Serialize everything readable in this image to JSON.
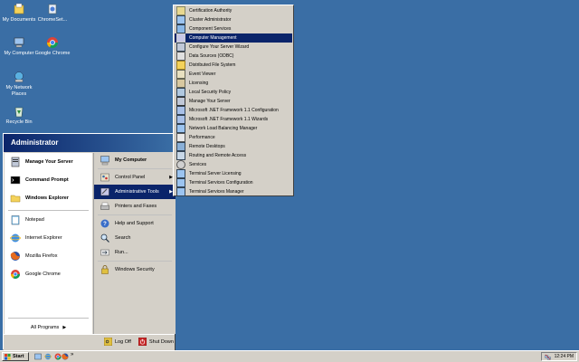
{
  "desktop": {
    "icons": [
      {
        "label": "My Documents",
        "icon": "my-documents-icon"
      },
      {
        "label": "ChromeSet...",
        "icon": "chrome-setup-icon"
      },
      {
        "label": "My Computer",
        "icon": "my-computer-icon"
      },
      {
        "label": "Google Chrome",
        "icon": "google-chrome-icon"
      },
      {
        "label": "My Network Places",
        "icon": "network-places-icon"
      },
      {
        "label": "Recycle Bin",
        "icon": "recycle-bin-icon"
      }
    ]
  },
  "start_menu": {
    "user": "Administrator",
    "left_pinned": [
      {
        "label": "Manage Your Server",
        "icon": "manage-server-icon"
      },
      {
        "label": "Command Prompt",
        "icon": "command-prompt-icon"
      },
      {
        "label": "Windows Explorer",
        "icon": "windows-explorer-icon"
      }
    ],
    "left_recent": [
      {
        "label": "Notepad",
        "icon": "notepad-icon"
      },
      {
        "label": "Internet Explorer",
        "icon": "internet-explorer-icon"
      },
      {
        "label": "Mozilla Firefox",
        "icon": "firefox-icon"
      },
      {
        "label": "Google Chrome",
        "icon": "google-chrome-icon"
      }
    ],
    "all_programs": "All Programs",
    "right_items": [
      {
        "label": "My Computer",
        "icon": "my-computer-icon"
      },
      {
        "label": "Control Panel",
        "icon": "control-panel-icon"
      },
      {
        "label": "Administrative Tools",
        "icon": "admin-tools-icon"
      },
      {
        "label": "Printers and Faxes",
        "icon": "printers-icon"
      },
      {
        "label": "Help and Support",
        "icon": "help-icon"
      },
      {
        "label": "Search",
        "icon": "search-icon"
      },
      {
        "label": "Run...",
        "icon": "run-icon"
      },
      {
        "label": "Windows Security",
        "icon": "security-icon"
      }
    ],
    "log_off": "Log Off",
    "shut_down": "Shut Down"
  },
  "admin_tools_menu": {
    "items": [
      "Certification Authority",
      "Cluster Administrator",
      "Component Services",
      "Computer Management",
      "Configure Your Server Wizard",
      "Data Sources (ODBC)",
      "Distributed File System",
      "Event Viewer",
      "Licensing",
      "Local Security Policy",
      "Manage Your Server",
      "Microsoft .NET Framework 1.1 Configuration",
      "Microsoft .NET Framework 1.1 Wizards",
      "Network Load Balancing Manager",
      "Performance",
      "Remote Desktops",
      "Routing and Remote Access",
      "Services",
      "Terminal Server Licensing",
      "Terminal Services Configuration",
      "Terminal Services Manager"
    ],
    "selected": "Computer Management"
  },
  "taskbar": {
    "start_label": "Start",
    "quick_launch_more": "»",
    "clock": "12:24 PM"
  },
  "colors": {
    "desktop": "#3a6ea5",
    "selection": "#0a246a",
    "face": "#d4d0c8"
  }
}
